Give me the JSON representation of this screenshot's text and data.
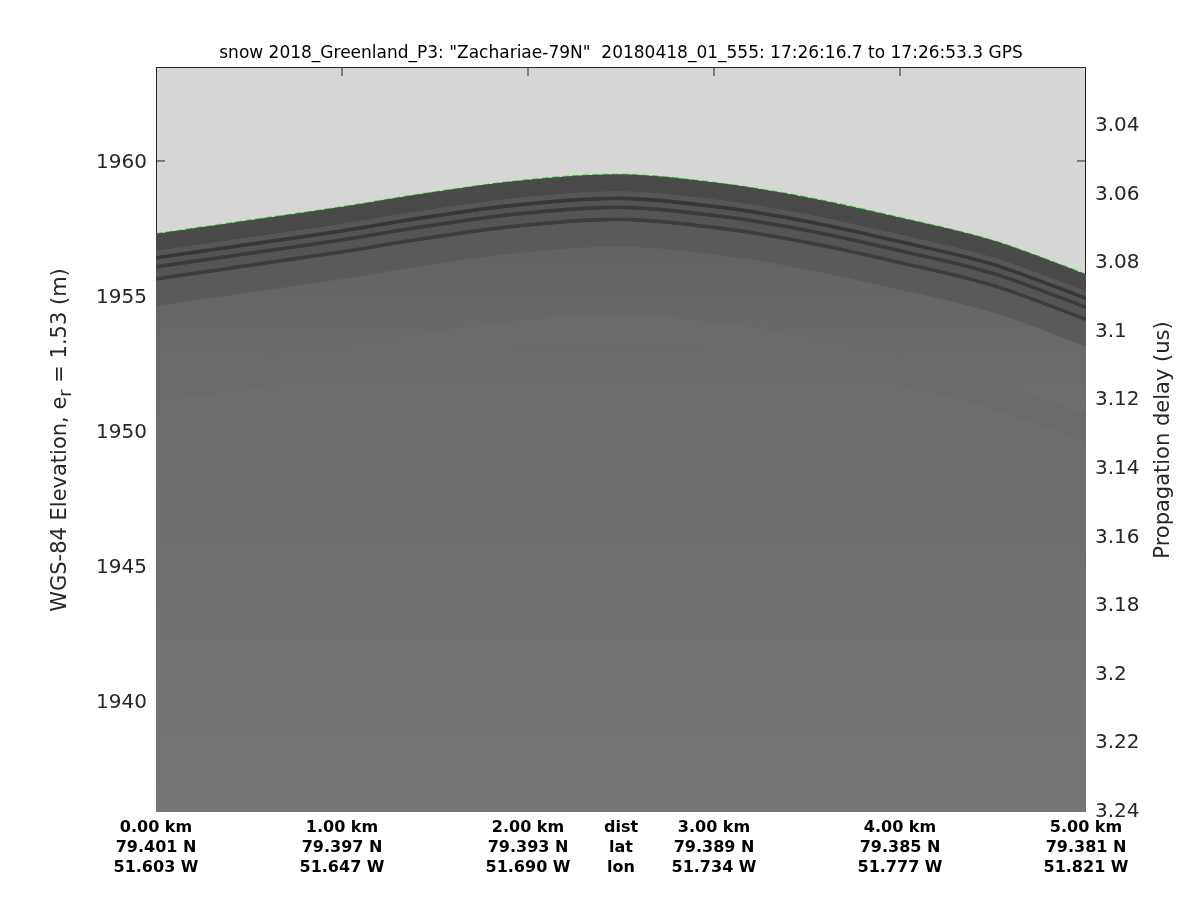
{
  "figure": {
    "chart_data": {
      "type": "line",
      "title": "snow 2018_Greenland_P3: \"Zachariae-79N\"  20180418_01_555: 17:26:16.7 to 17:26:53.3 GPS",
      "xlabel": "dist",
      "ylabel": "WGS-84 Elevation, e$_{r}$ = 1.53 (m)",
      "x": [
        0,
        0.5,
        1,
        1.5,
        2,
        2.5,
        3,
        3.5,
        4,
        4.5,
        5
      ],
      "series": [
        {
          "color": "#22dd22",
          "line_style": "dashed",
          "values": [
            1957.3,
            1957.8,
            1958.3,
            1958.85,
            1959.3,
            1959.5,
            1959.2,
            1958.65,
            1957.9,
            1957.05,
            1955.8
          ]
        }
      ],
      "xlim": [
        0,
        5
      ],
      "ylim": [
        1935.89,
        1963.48
      ],
      "xticks": [
        {
          "value": 0,
          "label": "0.00 km"
        },
        {
          "value": 1,
          "label": "1.00 km"
        },
        {
          "value": 2,
          "label": "2.00 km"
        },
        {
          "value": 3,
          "label": "3.00 km"
        },
        {
          "value": 4,
          "label": "4.00 km"
        },
        {
          "value": 5,
          "label": "5.00 km"
        }
      ],
      "yticks": [
        1940,
        1945,
        1950,
        1955,
        1960
      ],
      "y2label": "Propagation delay (us)",
      "y2lim": [
        3.2406,
        3.0234
      ],
      "y2ticks": [
        3.04,
        3.06,
        3.08,
        3.1,
        3.12,
        3.14,
        3.16,
        3.18,
        3.2,
        3.22,
        3.24
      ]
    },
    "xtick_rows": [
      {
        "label": "lat",
        "ticks": [
          "79.401 N",
          "79.397 N",
          "79.393 N",
          "79.389 N",
          "79.385 N",
          "79.381 N"
        ]
      },
      {
        "label": "lon",
        "ticks": [
          "51.603 W",
          "51.647 W",
          "51.690 W",
          "51.734 W",
          "51.777 W",
          "51.821 W"
        ]
      }
    ]
  }
}
